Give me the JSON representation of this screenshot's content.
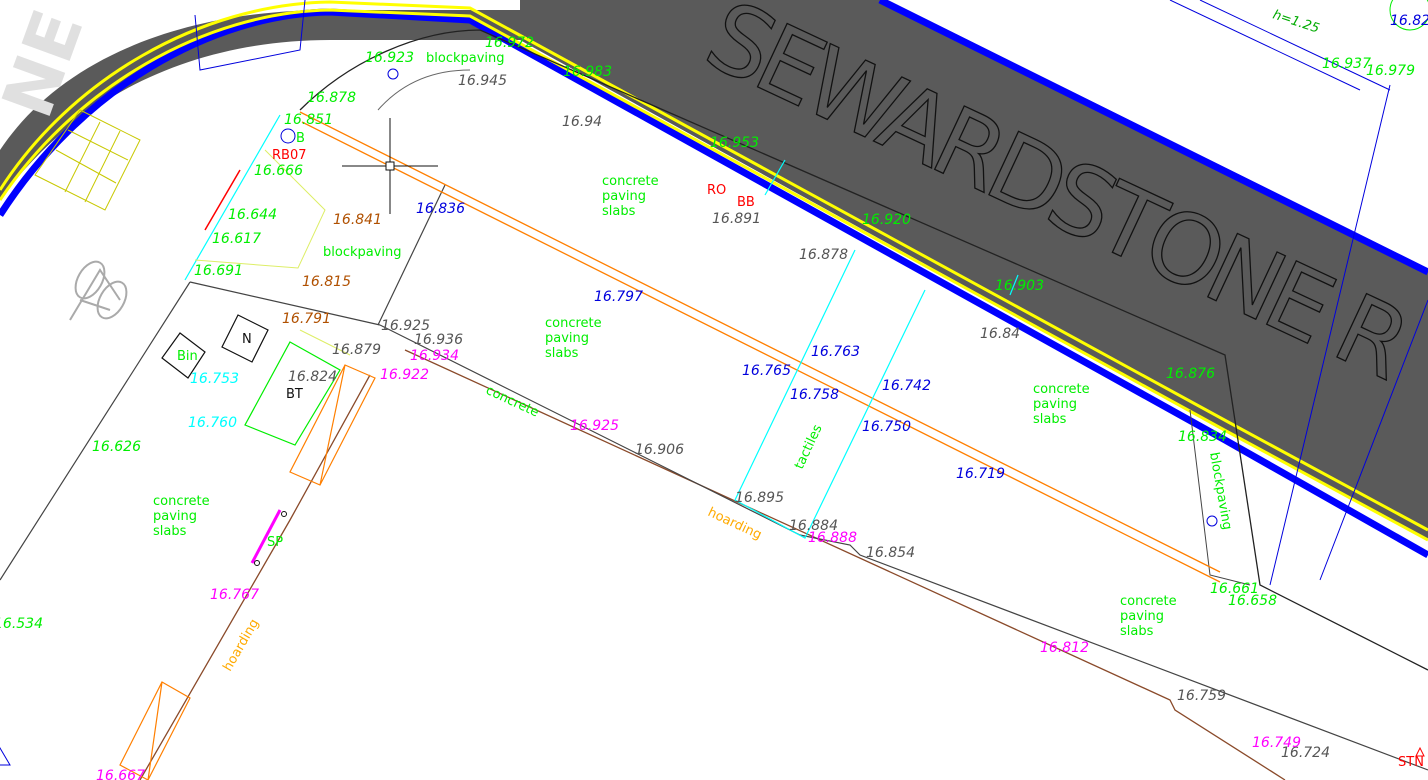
{
  "colors": {
    "road": "#5a5a5a",
    "kerb_blue": "#0000ff",
    "yellow_line": "#ffff00",
    "green_text": "#00ee00",
    "blue_text": "#0000dd",
    "grey_text": "#555555",
    "magenta_text": "#ff00ff",
    "cyan_text": "#00ffff",
    "brown_text": "#b05000",
    "orange": "#ff7f00",
    "red": "#ff0000",
    "paving_grid": "#c8c800"
  },
  "road_name": "SEWARDSTONE R",
  "road_fragment": "NE",
  "height_note": "h=1.25",
  "surface_labels": {
    "blockpaving_top": "blockpaving",
    "blockpaving_left": "blockpaving",
    "blockpaving_right": "blockpaving",
    "concrete": "concrete",
    "hoarding_bottom": "hoarding",
    "hoarding_left": "hoarding",
    "tactiles": "tactiles",
    "cps_line1": "concrete",
    "cps_line2": "paving",
    "cps_line3": "slabs"
  },
  "features": {
    "bin": "Bin",
    "n": "N",
    "bt": "BT",
    "sp": "SP",
    "b1": "B",
    "rb07": "RB07",
    "ro": "RO",
    "bb": "BB",
    "stn": "STN"
  },
  "spot_levels": {
    "g1": "16.923",
    "g2": "16.972",
    "g3": "16.983",
    "g4": "16.878",
    "g5": "16.851",
    "g6": "16.666",
    "g7": "16.644",
    "g8": "16.617",
    "g9": "16.691",
    "g10": "16.953",
    "g11": "16.920",
    "g12": "16.903",
    "g13": "16.876",
    "g14": "16.834",
    "g15": "16.661",
    "g16": "16.658",
    "g17": "16.937",
    "g18": "16.979",
    "g19": "16.626",
    "g20": "16.534",
    "b1": "16.836",
    "b2": "16.797",
    "b3": "16.763",
    "b4": "16.765",
    "b5": "16.758",
    "b6": "16.742",
    "b7": "16.750",
    "b8": "16.719",
    "k1": "16.945",
    "k2": "16.94",
    "k3": "16.891",
    "k4": "16.878",
    "k5": "16.84",
    "k6": "16.925",
    "k7": "16.936",
    "k8": "16.879",
    "k9": "16.824",
    "k10": "16.906",
    "k11": "16.895",
    "k12": "16.884",
    "k13": "16.854",
    "k14": "16.759",
    "k15": "16.724",
    "m1": "16.934",
    "m2": "16.922",
    "m3": "16.925",
    "m4": "16.888",
    "m5": "16.767",
    "m6": "16.812",
    "m7": "16.749",
    "m8": "16.667",
    "o1": "16.841",
    "o2": "16.815",
    "o3": "16.791",
    "c1": "16.753",
    "c2": "16.760",
    "bl1": "16.82"
  }
}
